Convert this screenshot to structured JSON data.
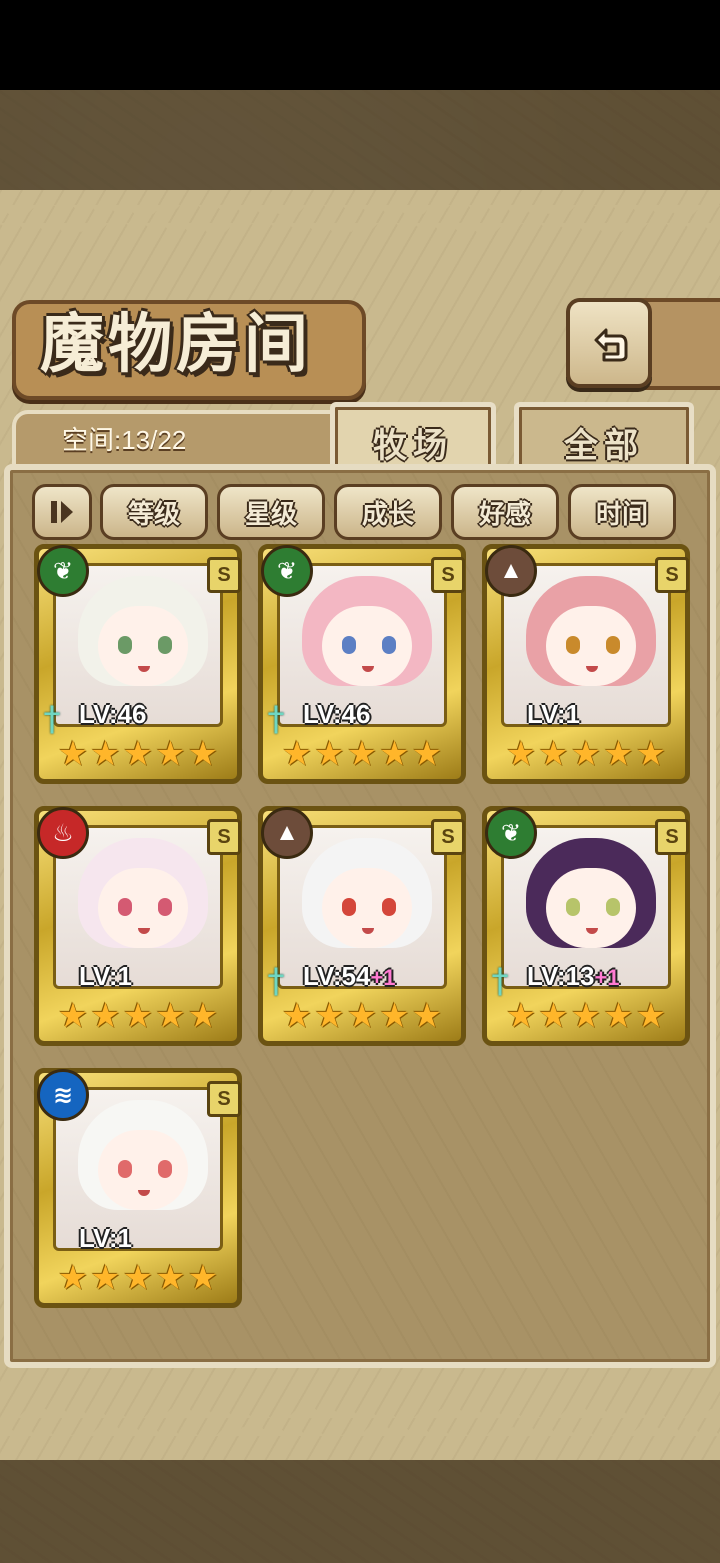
{
  "title": "魔物房间",
  "header": {
    "space_label": "空间:13/22"
  },
  "tabs": [
    {
      "label": "牧场",
      "active": true
    },
    {
      "label": "全部",
      "active": false
    }
  ],
  "sort_buttons": [
    "等级",
    "星级",
    "成长",
    "好感",
    "时间"
  ],
  "toggle_icon": "toggle-order-icon",
  "back_icon": "back-arrow-icon",
  "colors": {
    "nature": "#2e7d32",
    "earth": "#6d4c3a",
    "fire": "#c62828",
    "water": "#1565c0",
    "gold": "#e2c04a",
    "star": "#ffb62a"
  },
  "monsters": [
    {
      "element": "nature",
      "element_icon": "leaf-icon",
      "level": "LV:46",
      "bonus": "",
      "stars": 5,
      "rank": "S",
      "weapon_icon": "sword-icon",
      "hair": "#f2f2ea",
      "eye": "#6b9a66"
    },
    {
      "element": "nature",
      "element_icon": "leaf-icon",
      "level": "LV:46",
      "bonus": "",
      "stars": 5,
      "rank": "S",
      "weapon_icon": "sword-icon",
      "hair": "#f3b7c3",
      "eye": "#5c7fc4"
    },
    {
      "element": "earth",
      "element_icon": "mountain-icon",
      "level": "LV:1",
      "bonus": "",
      "stars": 5,
      "rank": "S",
      "weapon_icon": "",
      "hair": "#e9a1a6",
      "eye": "#c98a2c"
    },
    {
      "element": "fire",
      "element_icon": "flame-icon",
      "level": "LV:1",
      "bonus": "",
      "stars": 5,
      "rank": "S",
      "weapon_icon": "",
      "hair": "#f6e6ee",
      "eye": "#d45a72"
    },
    {
      "element": "earth",
      "element_icon": "mountain-icon",
      "level": "LV:54",
      "bonus": "+1",
      "stars": 5,
      "rank": "S",
      "weapon_icon": "sword-icon",
      "hair": "#f4f4f4",
      "eye": "#d4463a"
    },
    {
      "element": "nature",
      "element_icon": "leaf-icon",
      "level": "LV:13",
      "bonus": "+1",
      "stars": 5,
      "rank": "S",
      "weapon_icon": "sword-icon",
      "hair": "#4b2a5a",
      "eye": "#b7c46a"
    },
    {
      "element": "water",
      "element_icon": "water-waves-icon",
      "level": "LV:1",
      "bonus": "",
      "stars": 5,
      "rank": "S",
      "weapon_icon": "",
      "hair": "#f7f7f4",
      "eye": "#e06a6a"
    }
  ]
}
